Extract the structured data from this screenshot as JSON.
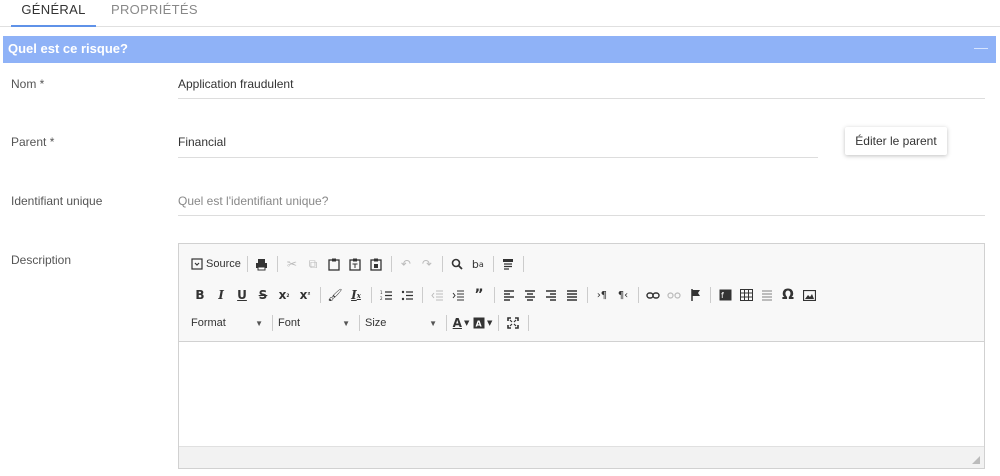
{
  "tabs": [
    {
      "label": "GÉNÉRAL"
    },
    {
      "label": "PROPRIÉTÉS"
    }
  ],
  "section": {
    "title": "Quel est ce risque?",
    "toggle": "—"
  },
  "fields": {
    "name": {
      "label": "Nom *",
      "value": "Application fraudulent"
    },
    "parent": {
      "label": "Parent  *",
      "value": "Financial",
      "button": "Éditer le parent"
    },
    "unique_id": {
      "label": "Identifiant unique",
      "placeholder": "Quel est l'identifiant unique?"
    },
    "description": {
      "label": "Description"
    }
  },
  "editor": {
    "source": "Source",
    "format": "Format",
    "font": "Font",
    "size": "Size",
    "icons": {
      "row1": [
        "source-icon",
        "print-icon",
        "cut-icon",
        "copy-icon",
        "paste-icon",
        "paste-text-icon",
        "paste-word-icon",
        "undo-icon",
        "redo-icon",
        "find-icon",
        "replace-icon",
        "spellcheck-icon"
      ],
      "row2": [
        "bold-icon",
        "italic-icon",
        "underline-icon",
        "strike-icon",
        "subscript-icon",
        "superscript-icon",
        "copy-format-icon",
        "remove-format-icon",
        "numbered-list-icon",
        "bulleted-list-icon",
        "outdent-icon",
        "indent-icon",
        "blockquote-icon",
        "align-left-icon",
        "align-center-icon",
        "align-right-icon",
        "justify-icon",
        "ltr-icon",
        "rtl-icon",
        "link-icon",
        "unlink-icon",
        "anchor-icon",
        "flash-icon",
        "table-icon",
        "horizontal-line-icon",
        "special-char-icon",
        "image-icon"
      ],
      "row3": [
        "text-color-icon",
        "bg-color-icon",
        "maximize-icon"
      ]
    }
  },
  "colors": {
    "accent": "#5f92e8",
    "section_header": "#8fb2f7"
  }
}
